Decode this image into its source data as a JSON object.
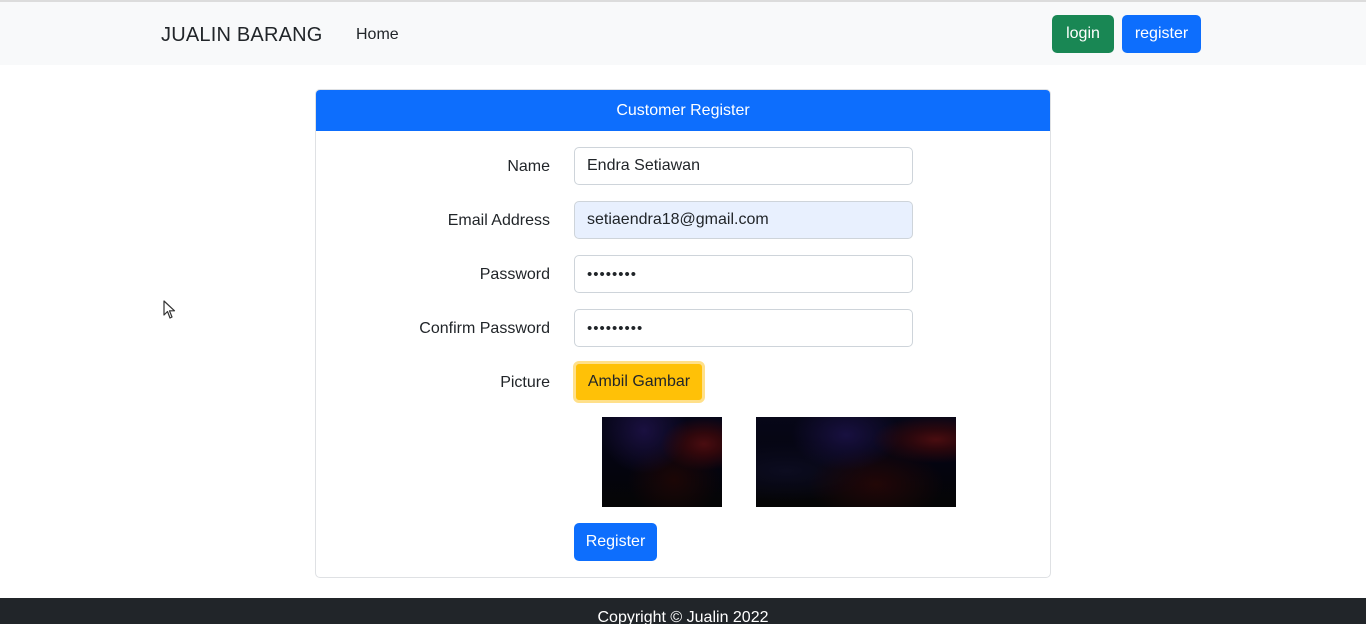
{
  "navbar": {
    "brand": "JUALIN BARANG",
    "home_link": "Home",
    "login_button": "login",
    "register_button": "register"
  },
  "form": {
    "header": "Customer Register",
    "fields": [
      {
        "label": "Name",
        "value": "Endra Setiawan"
      },
      {
        "label": "Email Address",
        "value": "setiaendra18@gmail.com"
      },
      {
        "label": "Password",
        "value": "••••••••"
      },
      {
        "label": "Confirm Password",
        "value": "•••••••••"
      }
    ],
    "picture_label": "Picture",
    "take_picture_button": "Ambil Gambar",
    "submit_button": "Register"
  },
  "footer": {
    "copyright": "Copyright © Jualin 2022"
  },
  "colors": {
    "primary": "#0d6efd",
    "success": "#198754",
    "warning": "#ffc107",
    "autofill": "#e8f0fe",
    "footer_bg": "#212529"
  }
}
